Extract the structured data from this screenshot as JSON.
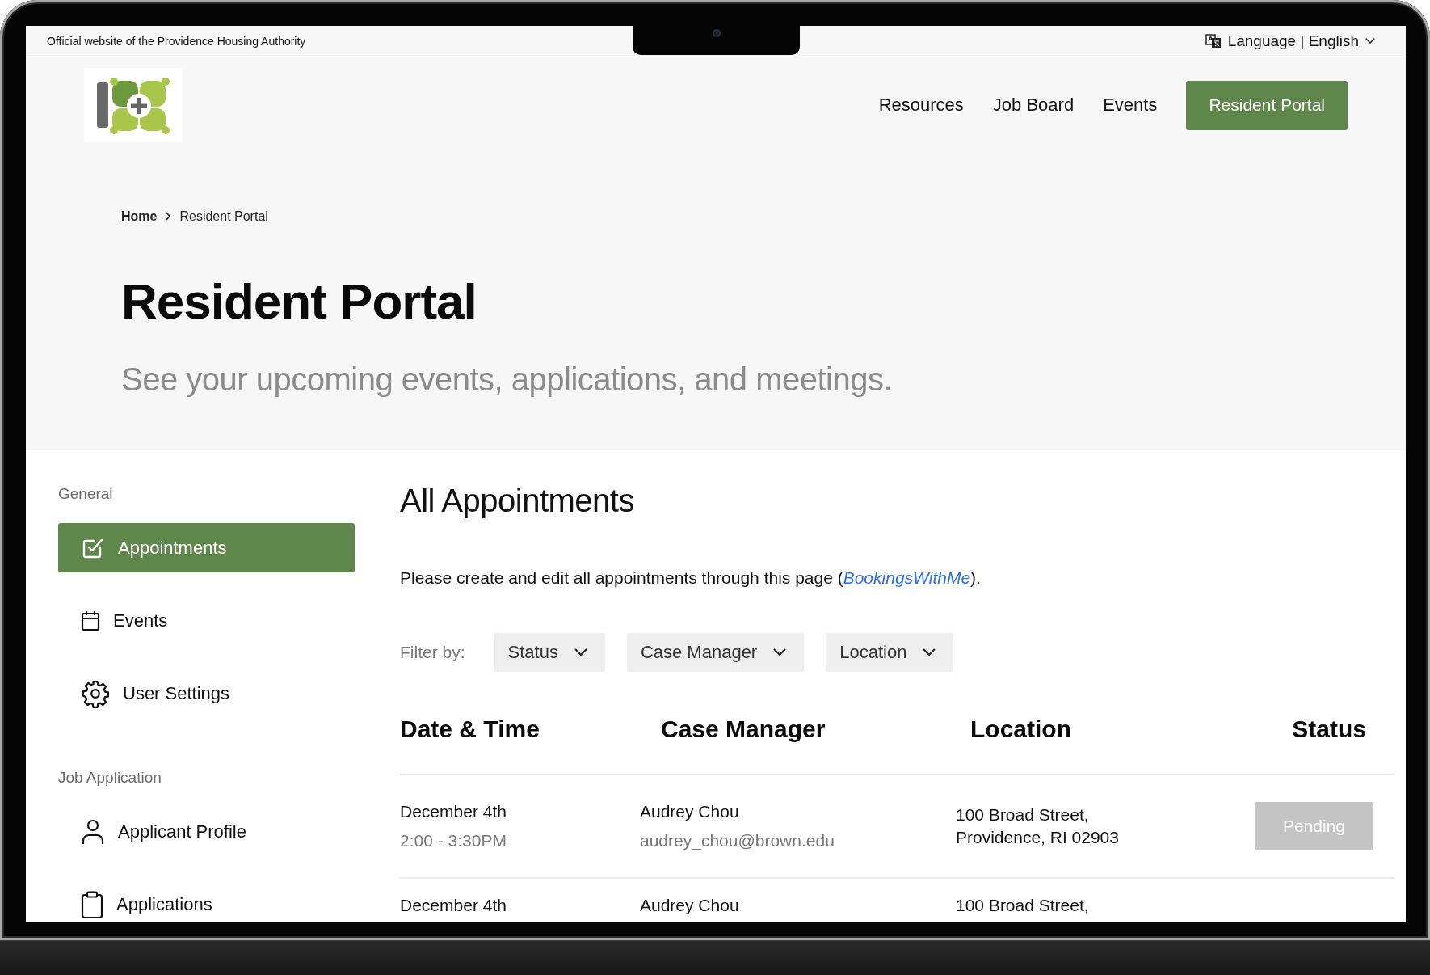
{
  "top_bar": {
    "text": "Official website of the Providence Housing Authority",
    "language": "Language | English"
  },
  "nav": {
    "links": [
      "Resources",
      "Job Board",
      "Events"
    ],
    "cta": "Resident Portal"
  },
  "breadcrumb": [
    {
      "label": "Home",
      "current": false
    },
    {
      "label": "Resident Portal",
      "current": true
    }
  ],
  "hero": {
    "title": "Resident Portal",
    "subtitle": "See your upcoming events, applications, and meetings."
  },
  "sidebar": {
    "sections": [
      {
        "heading": "General",
        "items": [
          {
            "label": "Appointments",
            "selected": true
          },
          {
            "label": "Events",
            "selected": false
          },
          {
            "label": "User Settings",
            "selected": false
          }
        ]
      },
      {
        "heading": "Job Application",
        "items": [
          {
            "label": "Applicant Profile",
            "selected": false
          },
          {
            "label": "Applications",
            "selected": false
          }
        ]
      }
    ]
  },
  "main": {
    "title": "All Appointments",
    "note_before": "Please create and edit all appointments through this page (",
    "note_link": "BookingsWithMe",
    "note_after": ")."
  },
  "filters": {
    "label": "Filter by:",
    "dropdowns": [
      "Status",
      "Case Manager",
      "Location"
    ]
  },
  "table": {
    "columns": [
      "Date & Time",
      "Case Manager",
      "Location",
      "Status"
    ],
    "rows": [
      {
        "date": "December 4th",
        "time": "2:00 - 3:30PM",
        "manager": "Audrey Chou",
        "email": "audrey_chou@brown.edu",
        "location": [
          "100 Broad Street,",
          "Providence, RI 02903"
        ],
        "status": "Pending"
      },
      {
        "date": "December 4th",
        "manager": "Audrey Chou",
        "location": [
          "100 Broad Street,"
        ]
      }
    ]
  }
}
